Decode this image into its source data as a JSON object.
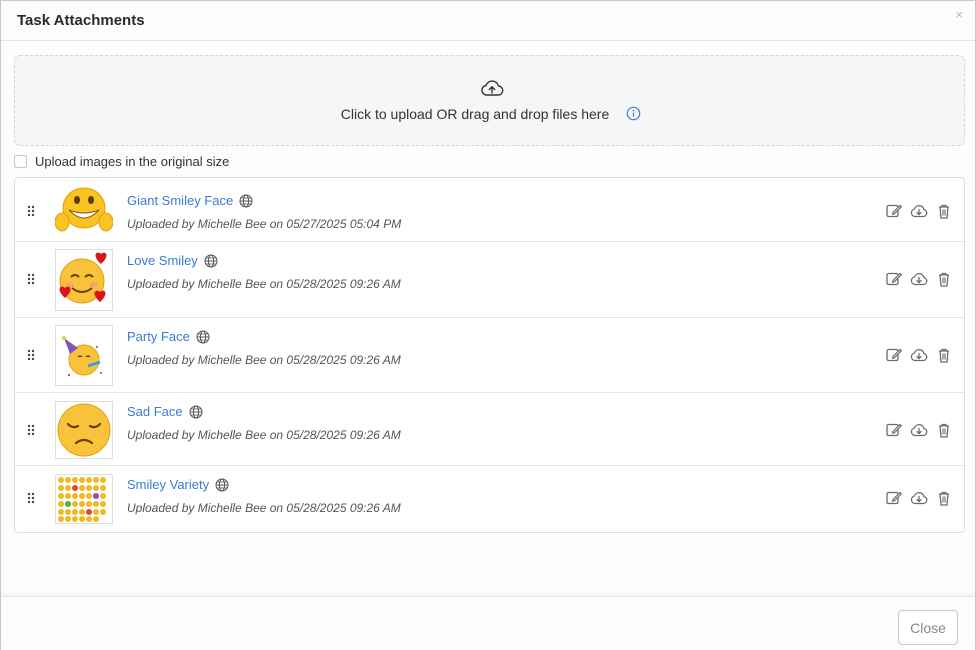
{
  "modal": {
    "title": "Task Attachments",
    "close_x": "×"
  },
  "dropzone": {
    "text": "Click to upload OR drag and drop files here",
    "upload_icon": "upload-cloud-icon",
    "info_icon": "info-icon"
  },
  "options": {
    "original_size_label": "Upload images in the original size",
    "original_size_checked": false
  },
  "attachments": [
    {
      "name": "Giant Smiley Face",
      "meta": "Uploaded by Michelle Bee on 05/27/2025 05:04 PM",
      "thumb": "giant-smiley-thumbnail"
    },
    {
      "name": "Love Smiley",
      "meta": "Uploaded by Michelle Bee on 05/28/2025 09:26 AM",
      "thumb": "love-smiley-thumbnail"
    },
    {
      "name": "Party Face",
      "meta": "Uploaded by Michelle Bee on 05/28/2025 09:26 AM",
      "thumb": "party-face-thumbnail"
    },
    {
      "name": "Sad Face",
      "meta": "Uploaded by Michelle Bee on 05/28/2025 09:26 AM",
      "thumb": "sad-face-thumbnail"
    },
    {
      "name": "Smiley Variety",
      "meta": "Uploaded by Michelle Bee on 05/28/2025 09:26 AM",
      "thumb": "smiley-variety-thumbnail"
    }
  ],
  "row_actions": [
    "edit-icon",
    "download-icon",
    "delete-icon"
  ],
  "footer": {
    "close_label": "Close"
  },
  "colors": {
    "link": "#3a7bd5",
    "icon": "#6b6b6b",
    "info": "#3a7bd5"
  }
}
